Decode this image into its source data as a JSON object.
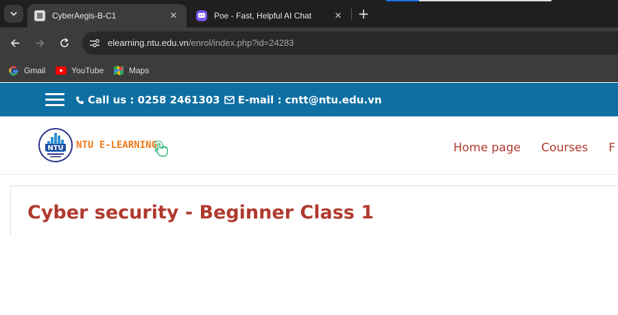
{
  "browser": {
    "tabs": [
      {
        "title": "CyberAegis-B-C1",
        "favicon": "document-icon",
        "active": true
      },
      {
        "title": "Poe - Fast, Helpful AI Chat",
        "favicon": "poe-icon",
        "active": false
      }
    ],
    "new_tab": "+",
    "close_glyph": "✕",
    "url_host": "elearning.ntu.edu.vn",
    "url_path": "/enrol/index.php?id=24283",
    "bookmarks": [
      {
        "label": "Gmail",
        "icon": "google-icon"
      },
      {
        "label": "YouTube",
        "icon": "youtube-icon"
      },
      {
        "label": "Maps",
        "icon": "maps-icon"
      }
    ]
  },
  "site": {
    "contact": {
      "phone_label": "Call us : 0258 2461303",
      "email_label": "E-mail : cntt@ntu.edu.vn"
    },
    "logo": {
      "badge_text": "NTU",
      "text": "NTU E-LEARNING"
    },
    "menu": [
      "Home page",
      "Courses",
      "F"
    ],
    "colors": {
      "topbar": "#0e6fa2",
      "accent": "#b03a2e",
      "logo_orange": "#f07a1a"
    }
  },
  "course": {
    "title": "Cyber security - Beginner Class 1"
  }
}
